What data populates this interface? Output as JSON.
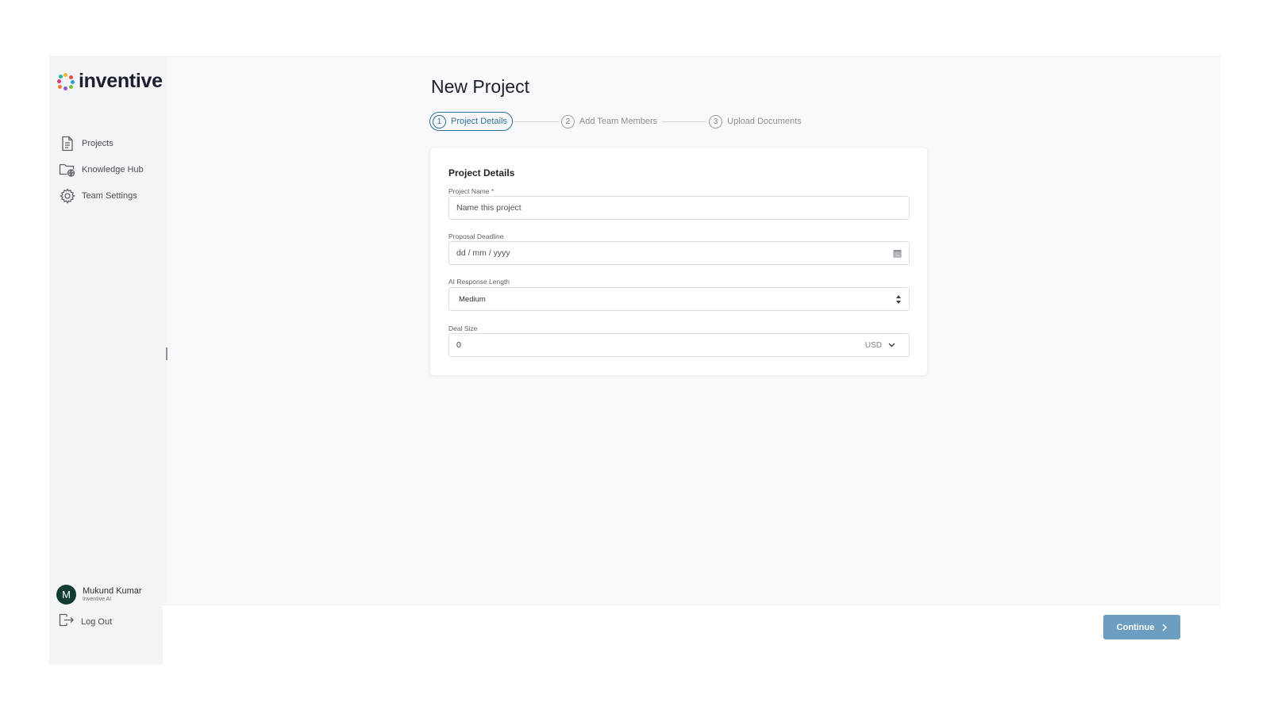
{
  "brand": {
    "name": "inventive",
    "colors": {
      "dot1": "#f2b233",
      "dot2": "#e8513b",
      "dot3": "#2a9ad6",
      "dot4": "#7ac143",
      "dot5": "#8c5bd1",
      "dot6": "#f07c2e",
      "dot7": "#d93a7e",
      "dot8": "#1fb6a6"
    }
  },
  "sidebar": {
    "items": [
      {
        "label": "Projects",
        "icon": "document-icon"
      },
      {
        "label": "Knowledge Hub",
        "icon": "folder-globe-icon"
      },
      {
        "label": "Team Settings",
        "icon": "gear-icon"
      }
    ],
    "user": {
      "initial": "M",
      "name": "Mukund Kumar",
      "org": "Inventive AI"
    },
    "logout_label": "Log Out"
  },
  "main": {
    "title": "New Project",
    "steps": [
      {
        "num": "1",
        "label": "Project Details",
        "active": true
      },
      {
        "num": "2",
        "label": "Add Team Members",
        "active": false
      },
      {
        "num": "3",
        "label": "Upload Documents",
        "active": false
      }
    ],
    "form": {
      "title": "Project Details",
      "project_name": {
        "label": "Project Name *",
        "placeholder": "Name this project",
        "value": ""
      },
      "deadline": {
        "label": "Proposal Deadline",
        "placeholder": "dd / mm / yyyy",
        "value": ""
      },
      "response_length": {
        "label": "AI Response Length",
        "value": "Medium"
      },
      "deal_size": {
        "label": "Deal Size",
        "value": "0",
        "currency": "USD"
      }
    }
  },
  "footer": {
    "continue_label": "Continue"
  },
  "colors": {
    "accent": "#2f6f9a",
    "button": "#6c9ec1",
    "avatar": "#123b34"
  }
}
